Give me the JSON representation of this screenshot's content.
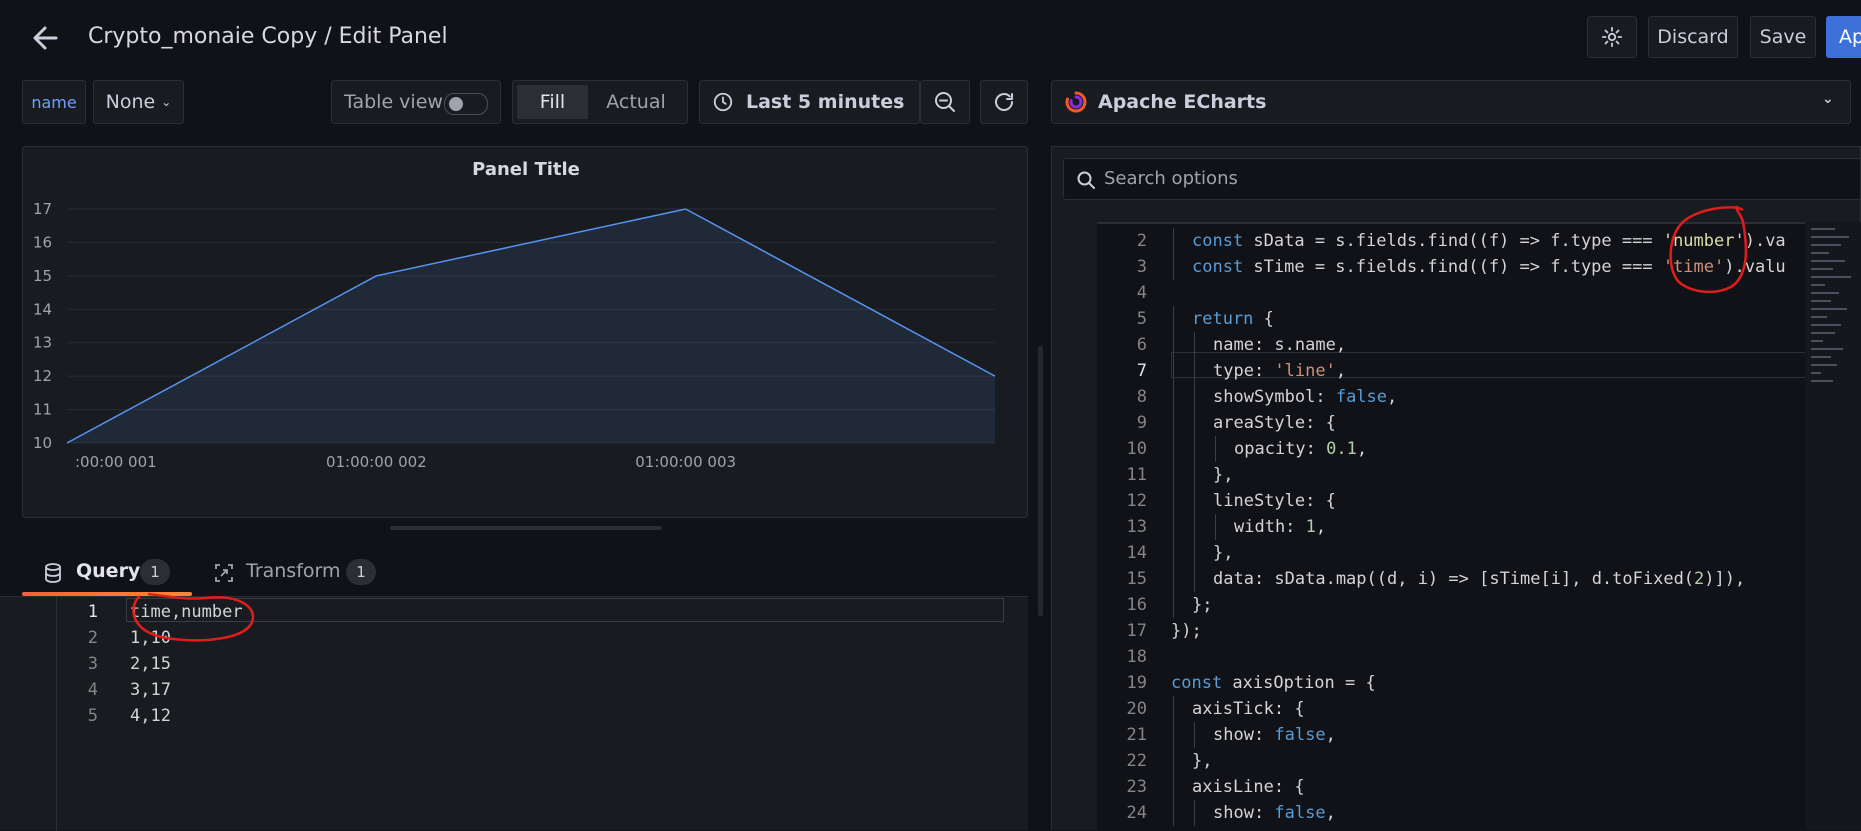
{
  "header": {
    "title": "Crypto_monaie Copy / Edit Panel",
    "discard_label": "Discard",
    "save_label": "Save",
    "apply_label": "Ap"
  },
  "toolbar": {
    "variable_name": "name",
    "variable_value": "None",
    "table_view_label": "Table view",
    "fill_label": "Fill",
    "actual_label": "Actual",
    "time_range": "Last 5 minutes",
    "visualization": "Apache ECharts",
    "search_placeholder": "Search options"
  },
  "panel": {
    "title": "Panel Title"
  },
  "chart_data": {
    "type": "area",
    "title": "Panel Title",
    "x": [
      1,
      2,
      3,
      4
    ],
    "series": [
      {
        "values": [
          10,
          15,
          17,
          12
        ]
      }
    ],
    "y_ticks": [
      "10",
      "11",
      "12",
      "13",
      "14",
      "15",
      "16",
      "17"
    ],
    "x_tick_labels": [
      ":00:00 001",
      "01:00:00 002",
      "01:00:00 003"
    ],
    "ylim": [
      10,
      17
    ],
    "grid": true,
    "colors": {
      "line": "#5794f2",
      "fill": "rgba(87,148,242,0.12)"
    }
  },
  "query_tabs": [
    {
      "label": "Query",
      "count": "1"
    },
    {
      "label": "Transform",
      "count": "1"
    }
  ],
  "query_lines": [
    {
      "n": "1",
      "text": "time,number"
    },
    {
      "n": "2",
      "text": "1,10"
    },
    {
      "n": "3",
      "text": "2,15"
    },
    {
      "n": "4",
      "text": "3,17"
    },
    {
      "n": "5",
      "text": "4,12"
    }
  ],
  "code_lines": [
    {
      "n": "2",
      "indent": 1,
      "tokens": [
        [
          "k",
          "const "
        ],
        [
          "p",
          "sData = s.fields.find((f) => f.type === "
        ],
        [
          "y",
          "'number'"
        ],
        [
          "p",
          ").va"
        ]
      ]
    },
    {
      "n": "3",
      "indent": 1,
      "tokens": [
        [
          "k",
          "const "
        ],
        [
          "p",
          "sTime = s.fields.find((f) => f.type === "
        ],
        [
          "s",
          "'time'"
        ],
        [
          "p",
          ").valu"
        ]
      ]
    },
    {
      "n": "4",
      "indent": 0,
      "tokens": []
    },
    {
      "n": "5",
      "indent": 1,
      "tokens": [
        [
          "k",
          "return "
        ],
        [
          "p",
          "{"
        ]
      ]
    },
    {
      "n": "6",
      "indent": 2,
      "tokens": [
        [
          "p",
          "name: s.name,"
        ]
      ]
    },
    {
      "n": "7",
      "indent": 2,
      "tokens": [
        [
          "p",
          "type: "
        ],
        [
          "s",
          "'line'"
        ],
        [
          "p",
          ","
        ]
      ]
    },
    {
      "n": "8",
      "indent": 2,
      "tokens": [
        [
          "p",
          "showSymbol: "
        ],
        [
          "k",
          "false"
        ],
        [
          "p",
          ","
        ]
      ]
    },
    {
      "n": "9",
      "indent": 2,
      "tokens": [
        [
          "p",
          "areaStyle: {"
        ]
      ]
    },
    {
      "n": "10",
      "indent": 3,
      "tokens": [
        [
          "p",
          "opacity: "
        ],
        [
          "n",
          "0.1"
        ],
        [
          "p",
          ","
        ]
      ]
    },
    {
      "n": "11",
      "indent": 2,
      "tokens": [
        [
          "p",
          "},"
        ]
      ]
    },
    {
      "n": "12",
      "indent": 2,
      "tokens": [
        [
          "p",
          "lineStyle: {"
        ]
      ]
    },
    {
      "n": "13",
      "indent": 3,
      "tokens": [
        [
          "p",
          "width: "
        ],
        [
          "n",
          "1"
        ],
        [
          "p",
          ","
        ]
      ]
    },
    {
      "n": "14",
      "indent": 2,
      "tokens": [
        [
          "p",
          "},"
        ]
      ]
    },
    {
      "n": "15",
      "indent": 2,
      "tokens": [
        [
          "p",
          "data: sData.map((d, i) => [sTime[i], d.toFixed("
        ],
        [
          "n",
          "2"
        ],
        [
          "p",
          ")]),"
        ]
      ]
    },
    {
      "n": "16",
      "indent": 1,
      "tokens": [
        [
          "p",
          "};"
        ]
      ]
    },
    {
      "n": "17",
      "indent": 0,
      "tokens": [
        [
          "p",
          "});"
        ]
      ]
    },
    {
      "n": "18",
      "indent": 0,
      "tokens": []
    },
    {
      "n": "19",
      "indent": 0,
      "tokens": [
        [
          "k",
          "const "
        ],
        [
          "p",
          "axisOption = {"
        ]
      ]
    },
    {
      "n": "20",
      "indent": 1,
      "tokens": [
        [
          "p",
          "axisTick: {"
        ]
      ]
    },
    {
      "n": "21",
      "indent": 2,
      "tokens": [
        [
          "p",
          "show: "
        ],
        [
          "k",
          "false"
        ],
        [
          "p",
          ","
        ]
      ]
    },
    {
      "n": "22",
      "indent": 1,
      "tokens": [
        [
          "p",
          "},"
        ]
      ]
    },
    {
      "n": "23",
      "indent": 1,
      "tokens": [
        [
          "p",
          "axisLine: {"
        ]
      ]
    },
    {
      "n": "24",
      "indent": 2,
      "tokens": [
        [
          "p",
          "show: "
        ],
        [
          "k",
          "false"
        ],
        [
          "p",
          ","
        ]
      ]
    }
  ],
  "icons": {
    "back": "arrow-left-icon",
    "settings": "gear-icon",
    "clock": "clock-icon",
    "zoom_out": "zoom-out-icon",
    "refresh": "refresh-icon",
    "search": "search-icon",
    "database": "database-icon",
    "transform": "transform-icon"
  }
}
